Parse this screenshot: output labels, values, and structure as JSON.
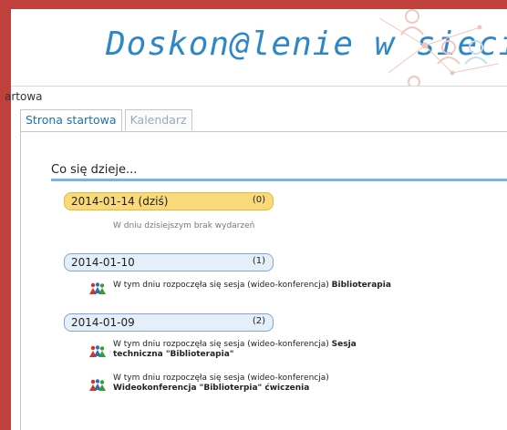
{
  "header": {
    "site_title": "Doskon@lenie w sieci"
  },
  "breadcrumb": "artowa",
  "tabs": [
    {
      "label": "Strona startowa",
      "active": true
    },
    {
      "label": "Kalendarz",
      "active": false
    }
  ],
  "section": {
    "title": "Co się dzieje..."
  },
  "days": [
    {
      "date": "2014-01-14 (dziś)",
      "count": "(0)",
      "no_events_text": "W dniu dzisiejszym brak wydarzeń"
    },
    {
      "date": "2014-01-10",
      "count": "(1)",
      "events": [
        {
          "line1_text": "W tym dniu rozpoczęła się sesja (wideo-konferencja) ",
          "line1_bold": "Biblioterapia"
        }
      ]
    },
    {
      "date": "2014-01-09",
      "count": "(2)",
      "events": [
        {
          "line1_text": "W tym dniu rozpoczęła się sesja (wideo-konferencja) ",
          "line1_bold": "Sesja",
          "line2_bold": "techniczna \"Biblioterapia\""
        },
        {
          "line1_text": "W tym dniu rozpoczęła się sesja (wideo-konferencja)",
          "line2_bold": "Wideokonferencja \"Biblioterpia\" ćwiczenia"
        }
      ]
    }
  ],
  "colors": {
    "frame_red": "#c0413b",
    "title_blue": "#2f87c8",
    "today_bg": "#fad97a",
    "past_bg": "#e4eff9",
    "rule_blue": "#7bb4e2"
  },
  "icons": {
    "event_icon": "people-icon"
  }
}
